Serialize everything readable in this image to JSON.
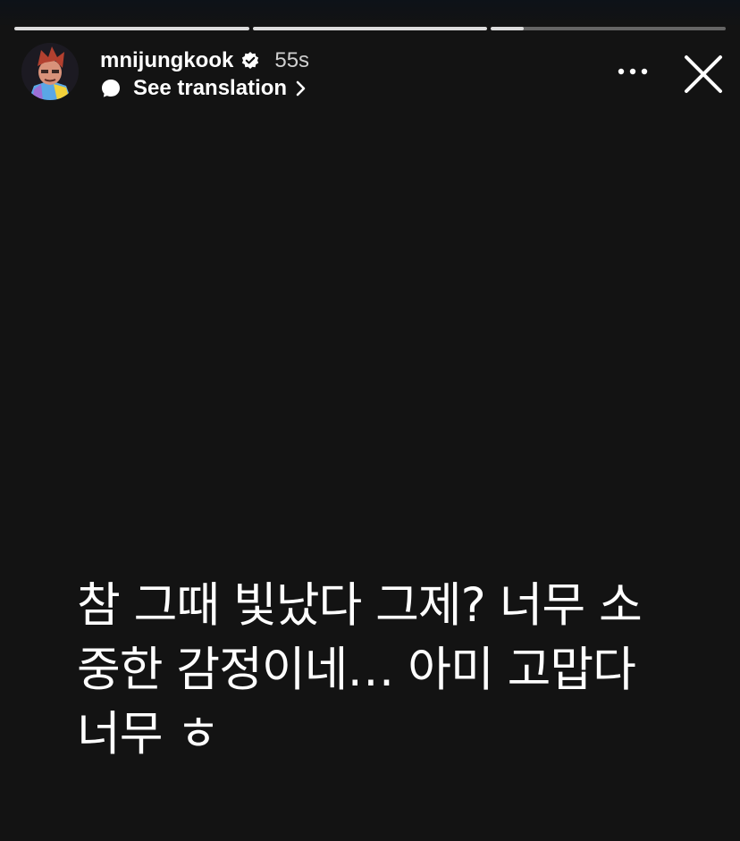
{
  "story": {
    "progress": [
      {
        "segment": 1,
        "filled_fraction": 1.0
      },
      {
        "segment": 2,
        "filled_fraction": 1.0
      },
      {
        "segment": 3,
        "filled_fraction": 0.14
      }
    ],
    "username": "mnijungkook",
    "verified": true,
    "time_ago": "55s",
    "translate_label": "See translation",
    "text_lines": [
      "참 그때 빛났다 그제? 너무 소",
      "중한 감정이네… 아미 고맙다",
      "너무 ㅎ"
    ]
  },
  "icons": {
    "verified": "verified-badge-icon",
    "translate": "speech-bubble-icon",
    "chevron": "chevron-right-icon",
    "more": "more-horizontal-icon",
    "close": "close-icon"
  },
  "colors": {
    "background": "#131313",
    "text": "#ffffff",
    "progress_track": "rgba(255,255,255,0.35)",
    "progress_fill": "#dcdcdc"
  }
}
